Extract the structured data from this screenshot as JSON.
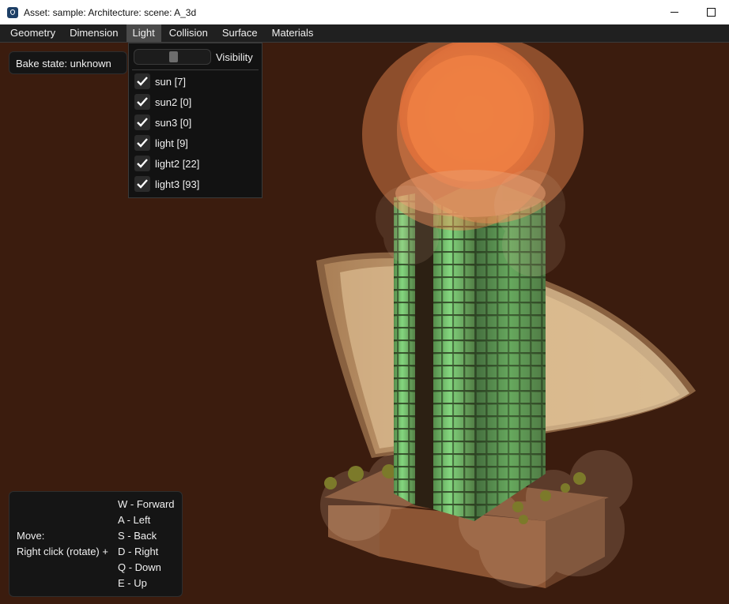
{
  "window": {
    "title": "Asset: sample: Architecture: scene: A_3d",
    "icon": "app-shield-icon",
    "controls": [
      "minimize-icon",
      "maximize-icon"
    ]
  },
  "menubar": {
    "items": [
      {
        "label": "Geometry"
      },
      {
        "label": "Dimension"
      },
      {
        "label": "Light",
        "active": true
      },
      {
        "label": "Collision"
      },
      {
        "label": "Surface"
      },
      {
        "label": "Materials"
      }
    ]
  },
  "bake": {
    "text": "Bake state: unknown"
  },
  "light_menu": {
    "visibility_label": "Visibility",
    "visibility_slider_value": 0.5,
    "lights": [
      {
        "label": "sun [7]",
        "checked": true
      },
      {
        "label": "sun2 [0]",
        "checked": true
      },
      {
        "label": "sun3 [0]",
        "checked": true
      },
      {
        "label": "light [9]",
        "checked": true
      },
      {
        "label": "light2 [22]",
        "checked": true
      },
      {
        "label": "light3 [93]",
        "checked": true
      }
    ]
  },
  "help": {
    "move_label": "Move:",
    "rotate_label": "Right click (rotate) +",
    "keys": [
      "W - Forward",
      "A - Left",
      "S - Back",
      "D - Right",
      "Q - Down",
      "E - Up"
    ]
  },
  "colors": {
    "background": "#3b1c0e",
    "menubar": "#202020",
    "active_menu": "#4a4a4a",
    "panel": "#151515",
    "light_sphere": "#f07a3c",
    "spot_cone": "#f4cf98",
    "glass_green": "#6fc26b"
  }
}
